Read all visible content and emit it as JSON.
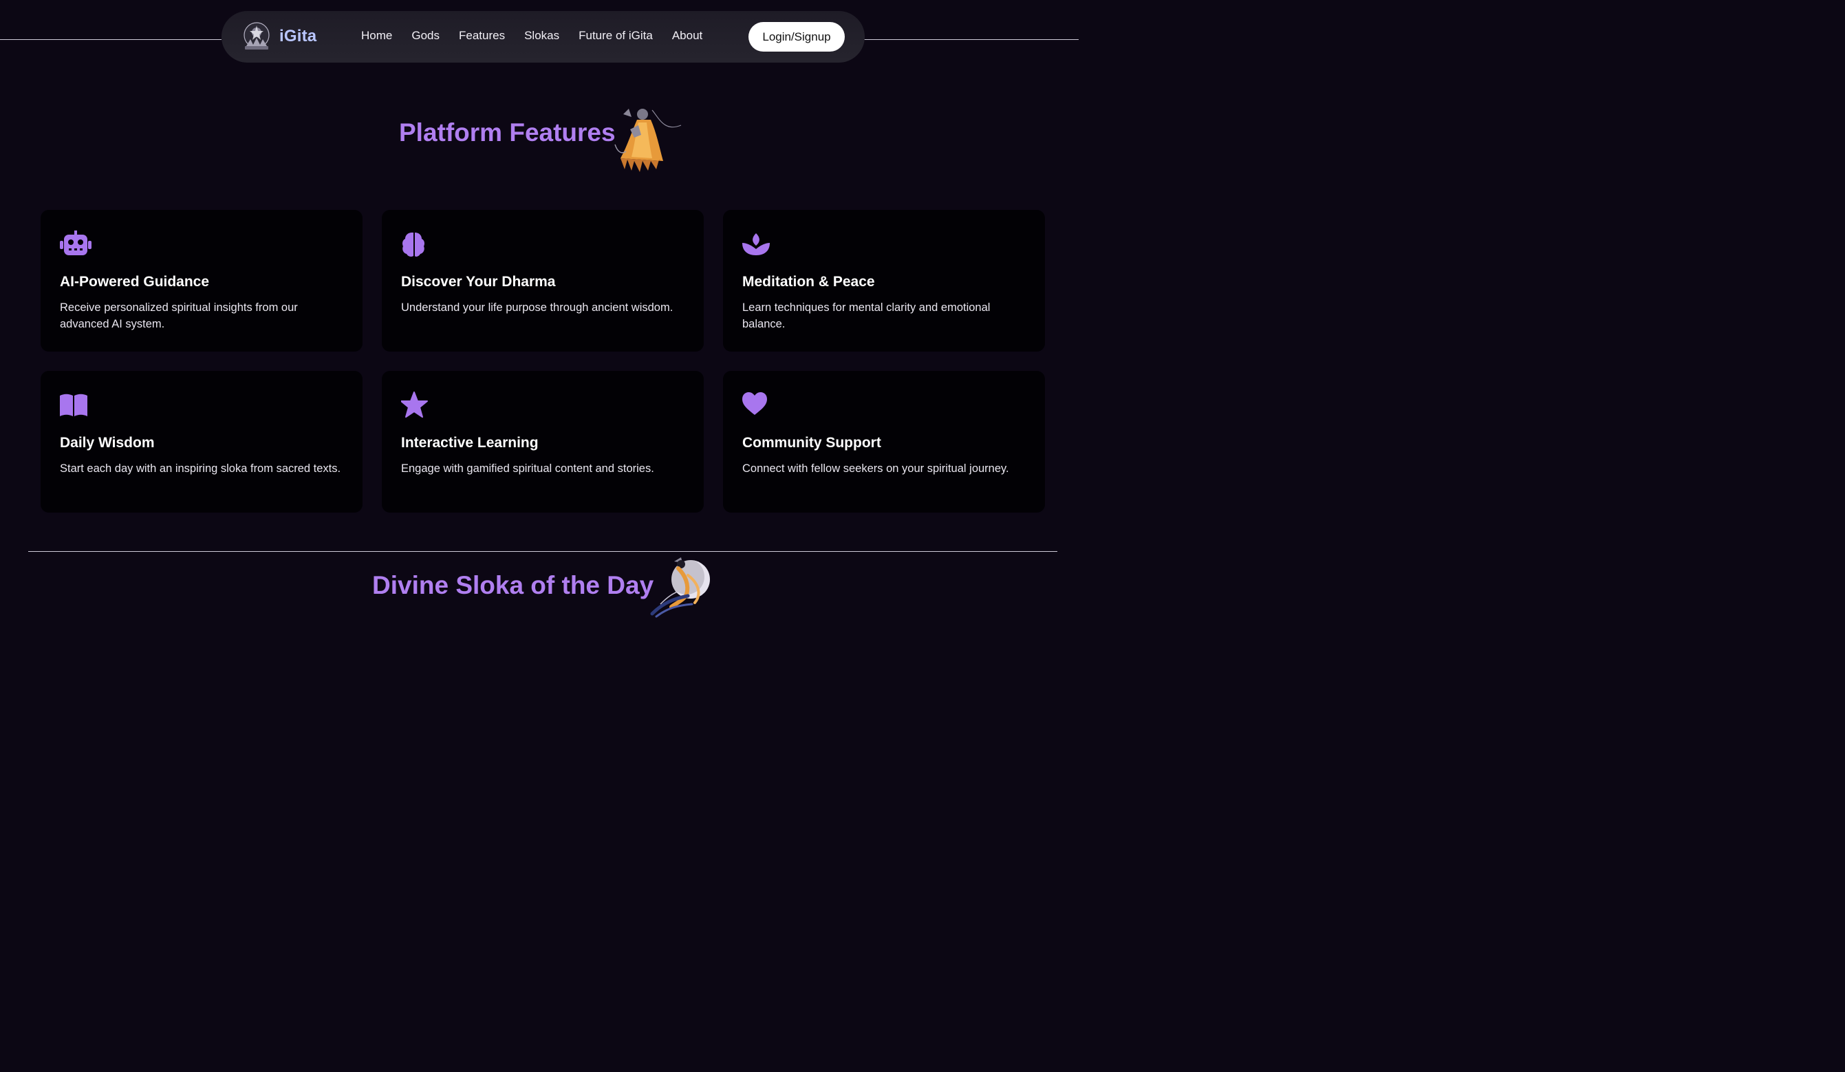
{
  "header": {
    "brand": "iGita",
    "nav": [
      "Home",
      "Gods",
      "Features",
      "Slokas",
      "Future of iGita",
      "About"
    ],
    "login_label": "Login/Signup"
  },
  "features": {
    "title": "Platform Features",
    "cards": [
      {
        "icon": "robot-icon",
        "title": "AI-Powered Guidance",
        "description": "Receive personalized spiritual insights from our advanced AI system."
      },
      {
        "icon": "brain-icon",
        "title": "Discover Your Dharma",
        "description": "Understand your life purpose through ancient wisdom."
      },
      {
        "icon": "lotus-icon",
        "title": "Meditation & Peace",
        "description": "Learn techniques for mental clarity and emotional balance."
      },
      {
        "icon": "book-icon",
        "title": "Daily Wisdom",
        "description": "Start each day with an inspiring sloka from sacred texts."
      },
      {
        "icon": "star-icon",
        "title": "Interactive Learning",
        "description": "Engage with gamified spiritual content and stories."
      },
      {
        "icon": "heart-icon",
        "title": "Community Support",
        "description": "Connect with fellow seekers on your spiritual journey."
      }
    ]
  },
  "sloka": {
    "title": "Divine Sloka of the Day"
  },
  "colors": {
    "background": "#0c0714",
    "accent": "#b07ff0",
    "brand": "#b9c6ff",
    "card": "#020105"
  }
}
